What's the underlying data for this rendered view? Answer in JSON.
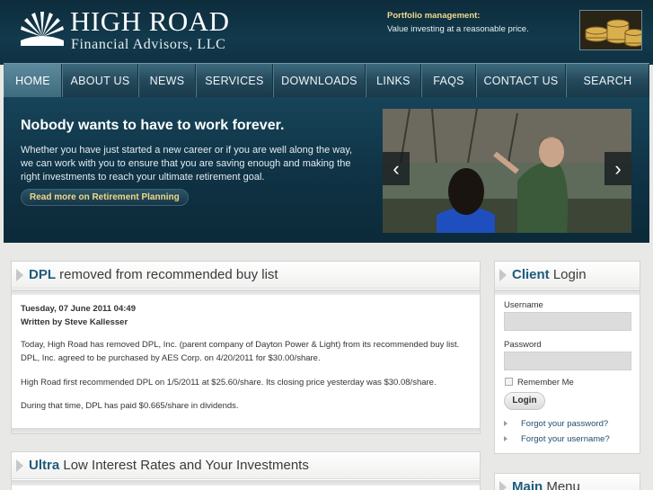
{
  "header": {
    "logo_title": "HIGH ROAD",
    "logo_subtitle": "Financial Advisors, LLC",
    "tagline_title": "Portfolio management:",
    "tagline_text": "Value investing at a reasonable price."
  },
  "nav": {
    "items": [
      {
        "label": "HOME",
        "active": true
      },
      {
        "label": "ABOUT US"
      },
      {
        "label": "NEWS"
      },
      {
        "label": "SERVICES"
      },
      {
        "label": "DOWNLOADS"
      },
      {
        "label": "LINKS"
      },
      {
        "label": "FAQS"
      },
      {
        "label": "CONTACT US"
      },
      {
        "label": "SEARCH"
      }
    ]
  },
  "banner": {
    "title": "Nobody wants to have to work forever.",
    "text": "Whether you have just started a new career or if you are well along the way, we can work with you to ensure that you are saving enough and making the right investments to reach your ultimate retirement goal.",
    "button": "Read more on Retirement Planning",
    "prev_arrow": "‹",
    "next_arrow": "›"
  },
  "article": {
    "title_highlight": "DPL",
    "title_rest": " removed from recommended buy list",
    "date": "Tuesday, 07 June 2011 04:49",
    "author": "Written by Steve Kallesser",
    "paragraphs": [
      "Today, High Road has removed DPL, Inc. (parent company of Dayton Power & Light) from its recommended buy list.  DPL, Inc. agreed to be purchased by AES Corp. on 4/20/2011 for $30.00/share.",
      "High Road first recommended DPL on 1/5/2011 at $25.60/share.  Its closing price yesterday was $30.08/share.",
      "During that time, DPL has paid $0.665/share in dividends."
    ]
  },
  "article2": {
    "title_highlight": "Ultra",
    "title_rest": " Low Interest Rates and Your Investments"
  },
  "login": {
    "title_highlight": "Client",
    "title_rest": " Login",
    "username_label": "Username",
    "password_label": "Password",
    "remember_label": "Remember Me",
    "button": "Login",
    "forgot_password": "Forgot your password?",
    "forgot_username": "Forgot your username?"
  },
  "main_menu": {
    "title_highlight": "Main",
    "title_rest": " Menu"
  }
}
